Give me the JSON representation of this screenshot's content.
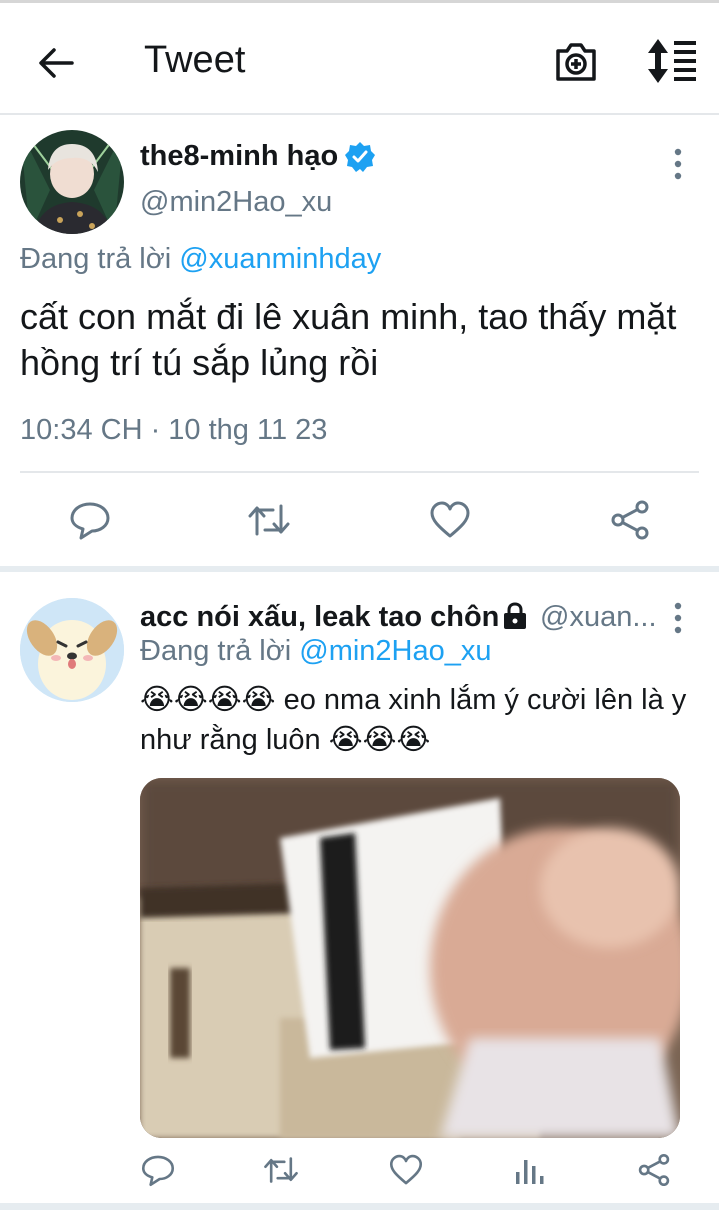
{
  "header": {
    "title": "Tweet",
    "back_icon": "arrow-left-icon",
    "camera_icon": "camera-plus-icon",
    "sort_icon": "sort-icon"
  },
  "main_tweet": {
    "display_name": "the8-minh hạo",
    "verified": true,
    "handle": "@min2Hao_xu",
    "reply_prefix": "Đang trả lời",
    "reply_to": "@xuanminhday",
    "text": "cất con mắt đi lê xuân minh, tao thấy mặt hồng trí tú sắp lủng rồi",
    "timestamp": "10:34 CH · 10 thg 11 23",
    "actions": [
      "reply-icon",
      "retweet-icon",
      "like-icon",
      "share-icon"
    ]
  },
  "reply_tweet": {
    "display_name": "acc nói xấu, leak tao chôn",
    "protected": true,
    "handle": "@xuan...",
    "reply_prefix": "Đang trả lời",
    "reply_to": "@min2Hao_xu",
    "emoji_before": "😭😭😭😭",
    "text_part1": "eo nma xinh lắm ý cười lên là y như rằng luôn",
    "emoji_after": "😭😭😭",
    "actions": [
      "reply-icon",
      "retweet-icon",
      "like-icon",
      "analytics-icon",
      "share-icon"
    ]
  },
  "colors": {
    "link": "#1da1f2",
    "secondary_text": "#657786",
    "primary_text": "#14171a",
    "divider": "#e4e7ea"
  }
}
